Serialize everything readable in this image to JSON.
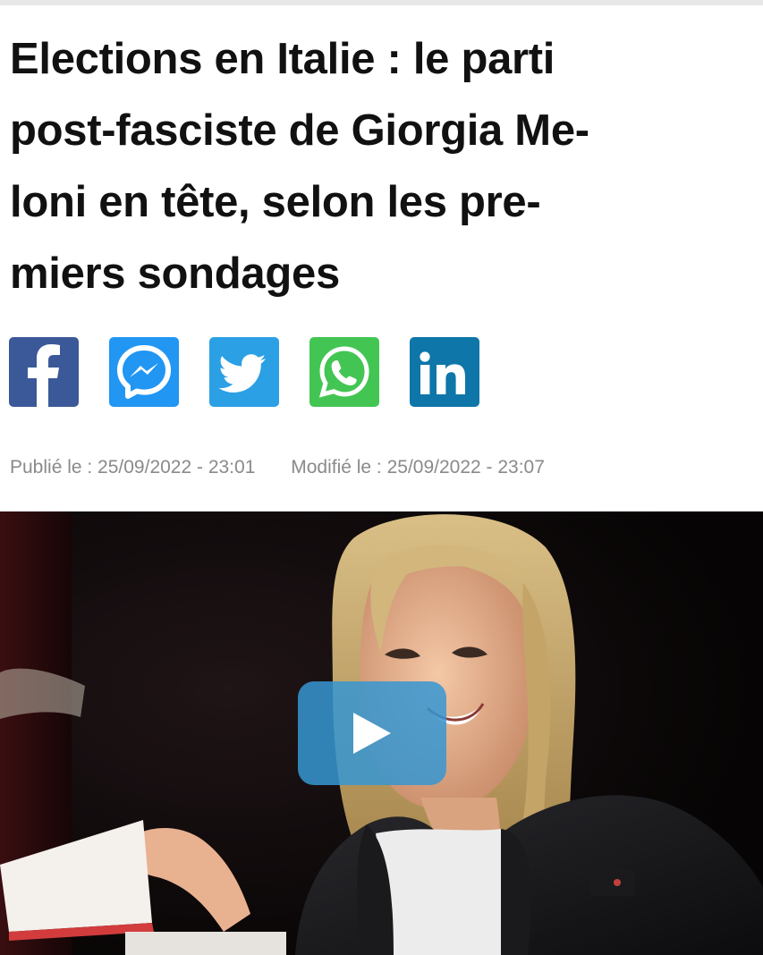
{
  "article": {
    "headline_lines": [
      "Elections en Italie : le parti",
      "post-fasciste de Giorgia Me-",
      "loni en tête, selon les pre-",
      "miers sondages"
    ],
    "published_label": "Publié le : 25/09/2022 - 23:01",
    "modified_label": "Modifié le : 25/09/2022 - 23:07"
  },
  "share": [
    {
      "name": "facebook",
      "icon": "facebook-icon",
      "color": "#3b5998"
    },
    {
      "name": "messenger",
      "icon": "messenger-icon",
      "color": "#2196f3"
    },
    {
      "name": "twitter",
      "icon": "twitter-icon",
      "color": "#2ba0e4"
    },
    {
      "name": "whatsapp",
      "icon": "whatsapp-icon",
      "color": "#43c553"
    },
    {
      "name": "linkedin",
      "icon": "linkedin-icon",
      "color": "#0e76a8"
    }
  ],
  "video": {
    "play_icon": "play-icon",
    "play_color": "#3696d2"
  }
}
